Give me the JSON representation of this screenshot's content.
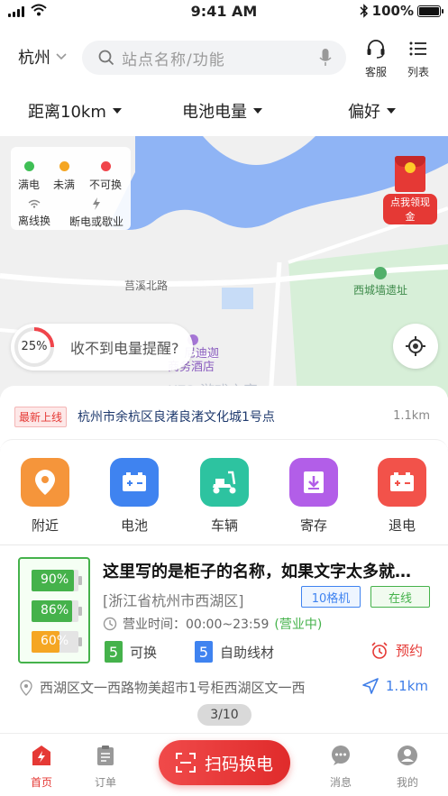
{
  "status_bar": {
    "time": "9:41 AM",
    "battery": "100%",
    "battery_level": 1.0
  },
  "header": {
    "city": "杭州",
    "search_placeholder": "站点名称/功能",
    "service_label": "客服",
    "list_label": "列表"
  },
  "filters": [
    {
      "label": "距离10km"
    },
    {
      "label": "电池电量"
    },
    {
      "label": "偏好"
    }
  ],
  "map": {
    "legend": [
      {
        "label": "满电",
        "color": "#3fbf55"
      },
      {
        "label": "未满",
        "color": "#f5a623"
      },
      {
        "label": "不可换",
        "color": "#f0454b"
      },
      {
        "label": "离线换",
        "icon": "wifi-icon"
      },
      {
        "label": "断电或歇业",
        "icon": "lightning-icon"
      }
    ],
    "road_label": "莒溪北路",
    "poi_label": "西城墙遗址",
    "hotel_label_1": "尼迪迦",
    "hotel_label_2": "商务酒店",
    "redpacket_label": "点我领现金",
    "reminder_percent": "25%",
    "reminder_fraction": 0.25,
    "reminder_text": "收不到电量提醒?",
    "watermark": "K73 游戏之家"
  },
  "notice": {
    "tag": "最新上线",
    "text": "杭州市余杭区良渚良渚文化城1号点",
    "distance": "1.1km"
  },
  "services": [
    {
      "label": "附近",
      "color": "#f5953b",
      "icon": "location-pin-icon"
    },
    {
      "label": "电池",
      "color": "#3f83f0",
      "icon": "battery-icon"
    },
    {
      "label": "车辆",
      "color": "#2dc3a0",
      "icon": "scooter-icon"
    },
    {
      "label": "寄存",
      "color": "#b25ee8",
      "icon": "storage-icon"
    },
    {
      "label": "退电",
      "color": "#f2524a",
      "icon": "return-battery-icon"
    }
  ],
  "station": {
    "batteries": [
      {
        "label": "90%",
        "level": 0.9,
        "color": "#45b24b"
      },
      {
        "label": "86%",
        "level": 0.86,
        "color": "#45b24b"
      },
      {
        "label": "60%",
        "level": 0.6,
        "color": "#f5a623"
      }
    ],
    "title": "这里写的是柜子的名称，如果文字太多就…",
    "region": "[浙江省杭州市西湖区]",
    "tag_cells": "10格机",
    "tag_status": "在线",
    "hours_label": "营业时间：00:00~23:59",
    "hours_status": "(营业中)",
    "available_count": "5",
    "available_label": "可换",
    "cable_count": "5",
    "cable_label": "自助线材",
    "reserve_label": "预约",
    "address": "西湖区文一西路物美超市1号柜西湖区文一西",
    "distance": "1.1km",
    "pager": "3/10"
  },
  "tabbar": {
    "home": "首页",
    "orders": "订单",
    "scan": "扫码换电",
    "messages": "消息",
    "mine": "我的"
  }
}
